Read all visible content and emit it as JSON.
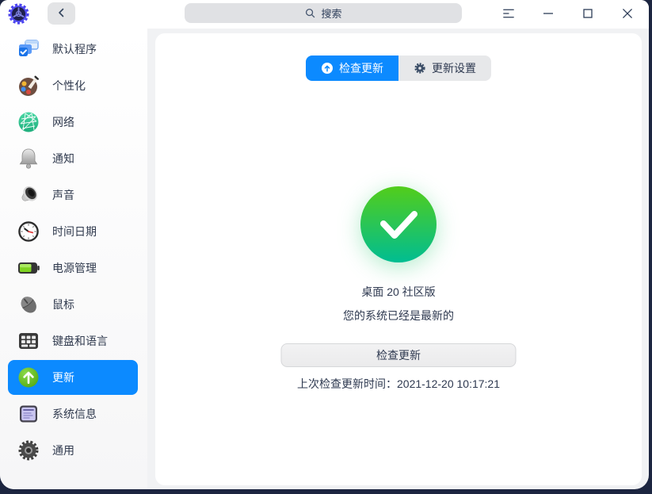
{
  "title_bar": {
    "search_placeholder": "搜索"
  },
  "sidebar": {
    "items": [
      {
        "key": "default-apps",
        "label": "默认程序",
        "icon": "default-apps-icon",
        "selected": false
      },
      {
        "key": "personalization",
        "label": "个性化",
        "icon": "personalization-icon",
        "selected": false
      },
      {
        "key": "network",
        "label": "网络",
        "icon": "network-icon",
        "selected": false
      },
      {
        "key": "notification",
        "label": "通知",
        "icon": "notification-icon",
        "selected": false
      },
      {
        "key": "sound",
        "label": "声音",
        "icon": "sound-icon",
        "selected": false
      },
      {
        "key": "datetime",
        "label": "时间日期",
        "icon": "datetime-icon",
        "selected": false
      },
      {
        "key": "power",
        "label": "电源管理",
        "icon": "power-icon",
        "selected": false
      },
      {
        "key": "mouse",
        "label": "鼠标",
        "icon": "mouse-icon",
        "selected": false
      },
      {
        "key": "keyboard",
        "label": "键盘和语言",
        "icon": "keyboard-icon",
        "selected": false
      },
      {
        "key": "update",
        "label": "更新",
        "icon": "update-icon",
        "selected": true
      },
      {
        "key": "system-info",
        "label": "系统信息",
        "icon": "system-info-icon",
        "selected": false
      },
      {
        "key": "general",
        "label": "通用",
        "icon": "general-icon",
        "selected": false
      }
    ]
  },
  "main": {
    "tabs": [
      {
        "key": "check-update",
        "label": "检查更新",
        "icon": "arrow-up-circle-icon",
        "active": true
      },
      {
        "key": "update-settings",
        "label": "更新设置",
        "icon": "gear-icon",
        "active": false
      }
    ],
    "version_label": "桌面 20 社区版",
    "status_text": "您的系统已经是最新的",
    "check_button_label": "检查更新",
    "last_check_label": "上次检查更新时间：",
    "last_check_time": "2021-12-20 10:17:21"
  },
  "colors": {
    "accent_blue": "#0c8aff",
    "success_green_top": "#52cd1b",
    "success_green_bottom": "#00bd92",
    "selected_item_bg": "#0c8aff",
    "panel_bg": "#ffffff",
    "window_bg": "#f1f2f4",
    "desktop_bg": "#1c2540"
  }
}
